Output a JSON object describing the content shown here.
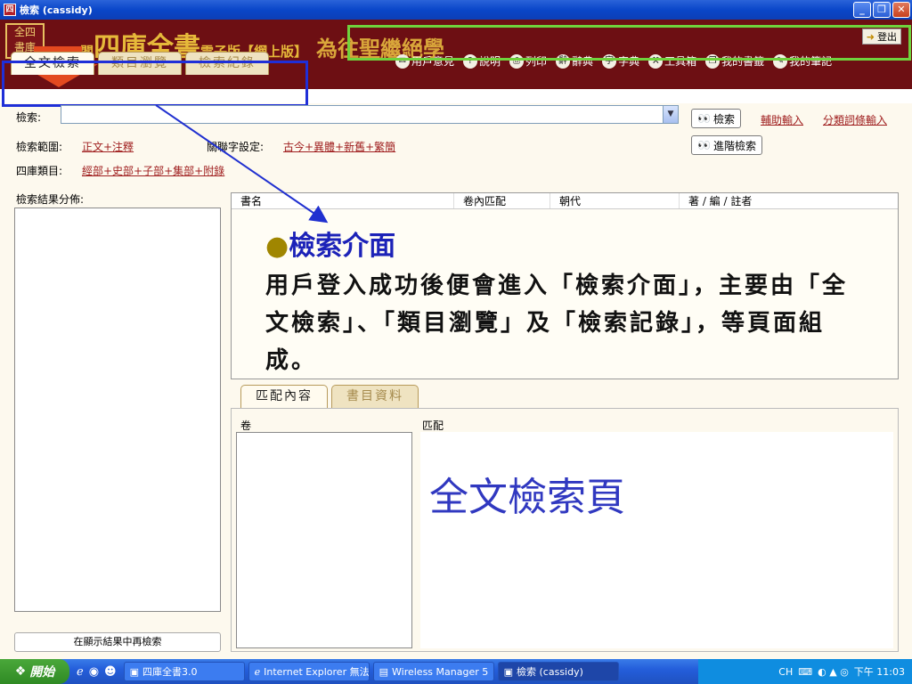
{
  "window": {
    "app_icon": "四",
    "title": "檢索 (cassidy)"
  },
  "header": {
    "logo_text": "全四\n書庫",
    "logo_line1": "全四",
    "logo_line2": "書庫",
    "title_prefix": "閣",
    "title_main": "四庫全書",
    "title_edition": "電子版【網上版】",
    "motto": "為往聖繼絕學",
    "exit_label": "登出",
    "toolbar": [
      {
        "label": "用戶意見",
        "icon": "feedback-icon",
        "glyph": "✉"
      },
      {
        "label": "說明",
        "icon": "help-icon",
        "glyph": "?"
      },
      {
        "label": "列印",
        "icon": "print-icon",
        "glyph": "⎙"
      },
      {
        "label": "辭典",
        "icon": "dictionary-icon",
        "glyph": "辭"
      },
      {
        "label": "字典",
        "icon": "character-dictionary-icon",
        "glyph": "字"
      },
      {
        "label": "工具箱",
        "icon": "toolbox-icon",
        "glyph": "⚒"
      },
      {
        "label": "我的書籤",
        "icon": "bookmark-icon",
        "glyph": "❐"
      },
      {
        "label": "我的筆記",
        "icon": "notes-icon",
        "glyph": "✎"
      }
    ],
    "window_buttons": {
      "minimize": "_",
      "maximize": "❐",
      "close": "✕"
    }
  },
  "tabs": [
    "全文檢索",
    "類目瀏覽",
    "檢索紀錄"
  ],
  "search": {
    "label": "檢索:",
    "value": "",
    "search_button": "檢索",
    "advanced_button": "進階檢索",
    "assist_link": "輔助輸入",
    "classified_link": "分類詞條輸入",
    "scope_label": "檢索範圍:",
    "scope_value": "正文+注釋",
    "keyword_label": "關聯字設定:",
    "keyword_value": "古今+異體+新舊+繁簡",
    "category_label": "四庫類目:",
    "category_value": "經部+史部+子部+集部+附錄",
    "distribution_label": "檢索結果分佈:",
    "refine_button": "在顯示結果中再檢索"
  },
  "results_table": {
    "columns": [
      "書名",
      "卷內匹配",
      "朝代",
      "著 / 編 / 註者"
    ]
  },
  "annotation": {
    "bullet": "●",
    "title": "檢索介面",
    "body": "用戶登入成功後便會進入「檢索介面」，主要由「全文檢索」、「類目瀏覽」及「檢索記錄」，等頁面組成。"
  },
  "lower_tabs": [
    "匹配內容",
    "書目資料"
  ],
  "lower": {
    "vol_label": "卷",
    "match_label": "匹配",
    "big_caption": "全文檢索頁"
  },
  "taskbar": {
    "start": "開始",
    "tasks": [
      "四庫全書3.0",
      "Internet Explorer 無法...",
      "Wireless Manager 5",
      "檢索 (cassidy)"
    ],
    "lang": "CH",
    "clock": "下午 11:03"
  },
  "colors": {
    "banner": "#6d0f13",
    "gold": "#e6b93a",
    "annotation_blue": "#1c22b8",
    "highlight_green": "#6fd23d",
    "highlight_blue": "#1f2fd8",
    "arrow_red": "#e34a1f"
  }
}
